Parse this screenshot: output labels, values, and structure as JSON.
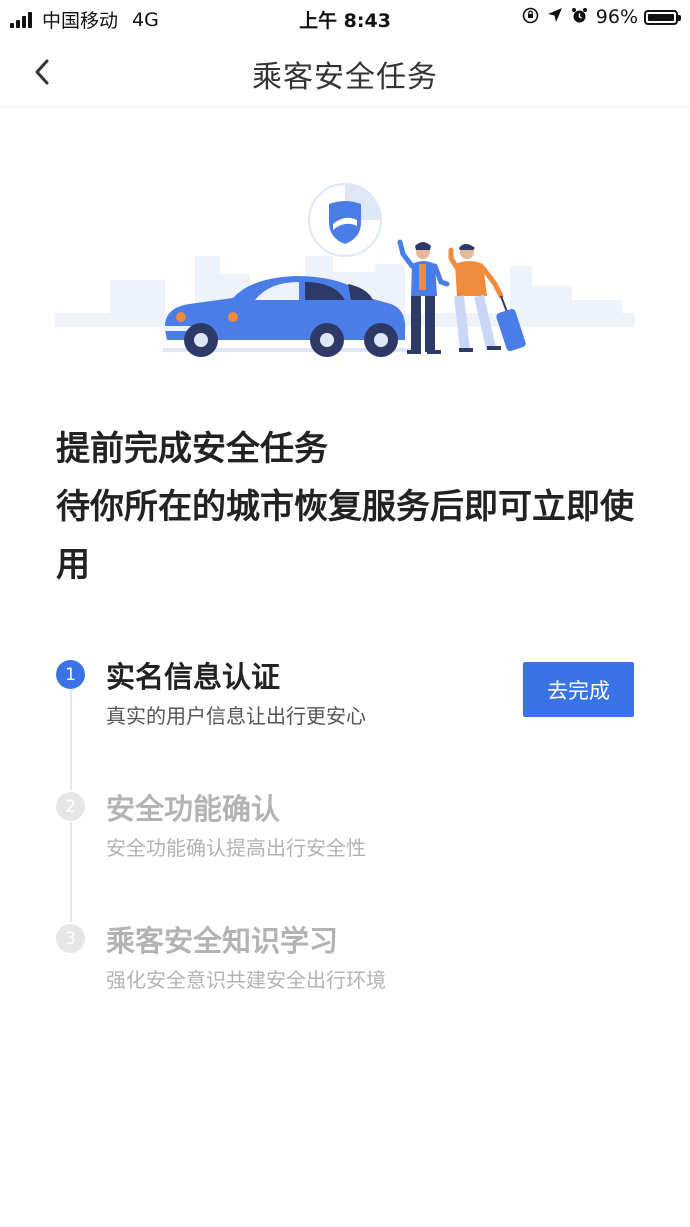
{
  "status": {
    "carrier": "中国移动",
    "network": "4G",
    "time": "上午 8:43",
    "battery": "96%"
  },
  "nav": {
    "title": "乘客安全任务"
  },
  "headline": {
    "line1": "提前完成安全任务",
    "line2": "待你所在的城市恢复服务后即可立即使用"
  },
  "steps": [
    {
      "num": "1",
      "title": "实名信息认证",
      "desc": "真实的用户信息让出行更安心",
      "state": "active"
    },
    {
      "num": "2",
      "title": "安全功能确认",
      "desc": "安全功能确认提高出行安全性",
      "state": "inactive"
    },
    {
      "num": "3",
      "title": "乘客安全知识学习",
      "desc": "强化安全意识共建安全出行环境",
      "state": "inactive"
    }
  ],
  "action": {
    "complete_label": "去完成"
  },
  "colors": {
    "accent": "#3a73e5",
    "inactive": "#b3b3b3",
    "car": "#4a7de8",
    "shirt": "#f08a3c"
  }
}
